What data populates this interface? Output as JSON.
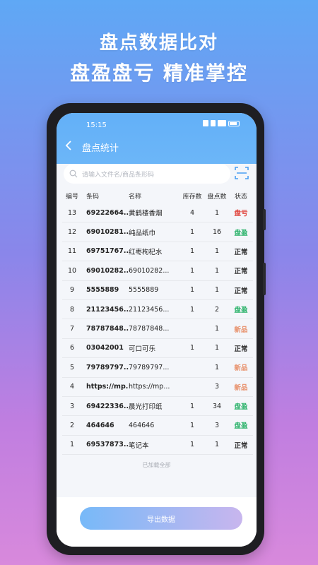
{
  "promo": {
    "line1": "盘点数据比对",
    "line2": "盘盈盘亏 精准掌控"
  },
  "status_bar": {
    "time": "15:15"
  },
  "header": {
    "title": "盘点统计"
  },
  "search": {
    "placeholder": "请输入文件名/商品条形码"
  },
  "table": {
    "headers": {
      "no": "编号",
      "code": "条码",
      "name": "名称",
      "stock": "库存数",
      "count": "盘点数",
      "status": "状态"
    },
    "rows": [
      {
        "no": "13",
        "code": "69222664...",
        "name": "黄鹤楼香烟",
        "stock": "4",
        "count": "1",
        "status": "盘亏",
        "status_color": "#e0423a"
      },
      {
        "no": "12",
        "code": "69010281...",
        "name": "纯品纸巾",
        "stock": "1",
        "count": "16",
        "status": "盘盈",
        "status_color": "#2cb36b"
      },
      {
        "no": "11",
        "code": "69751767...",
        "name": "红枣枸杞水",
        "stock": "1",
        "count": "1",
        "status": "正常",
        "status_color": "#333333"
      },
      {
        "no": "10",
        "code": "69010282...",
        "name": "69010282...",
        "stock": "1",
        "count": "1",
        "status": "正常",
        "status_color": "#333333"
      },
      {
        "no": "9",
        "code": "5555889",
        "name": "5555889",
        "stock": "1",
        "count": "1",
        "status": "正常",
        "status_color": "#333333"
      },
      {
        "no": "8",
        "code": "21123456...",
        "name": "21123456...",
        "stock": "1",
        "count": "2",
        "status": "盘盈",
        "status_color": "#2cb36b"
      },
      {
        "no": "7",
        "code": "78787848...",
        "name": "78787848...",
        "stock": "",
        "count": "1",
        "status": "新品",
        "status_color": "#e8906a"
      },
      {
        "no": "6",
        "code": "03042001",
        "name": "可口可乐",
        "stock": "1",
        "count": "1",
        "status": "正常",
        "status_color": "#333333"
      },
      {
        "no": "5",
        "code": "79789797...",
        "name": "79789797...",
        "stock": "",
        "count": "1",
        "status": "新品",
        "status_color": "#e8906a"
      },
      {
        "no": "4",
        "code": "https://mp...",
        "name": "https://mp...",
        "stock": "",
        "count": "3",
        "status": "新品",
        "status_color": "#e8906a"
      },
      {
        "no": "3",
        "code": "69422336...",
        "name": "晨光打印纸",
        "stock": "1",
        "count": "34",
        "status": "盘盈",
        "status_color": "#2cb36b"
      },
      {
        "no": "2",
        "code": "464646",
        "name": "464646",
        "stock": "1",
        "count": "3",
        "status": "盘盈",
        "status_color": "#2cb36b"
      },
      {
        "no": "1",
        "code": "69537873...",
        "name": "笔记本",
        "stock": "1",
        "count": "1",
        "status": "正常",
        "status_color": "#333333"
      }
    ]
  },
  "footer": {
    "loaded_text": "已加载全部",
    "export_label": "导出数据"
  }
}
